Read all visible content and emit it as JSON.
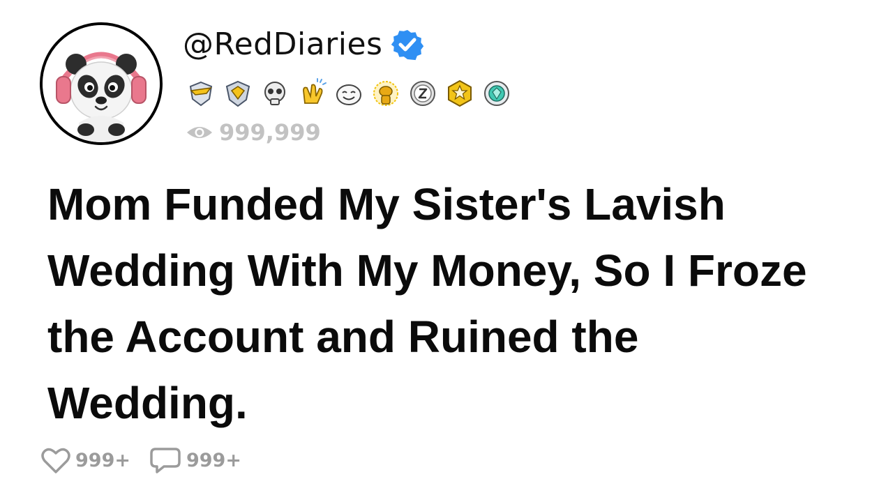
{
  "profile": {
    "username": "@RedDiaries",
    "verified": true,
    "views": "999,999",
    "badges": [
      "shield-wings-badge-icon",
      "diamond-shield-badge-icon",
      "skull-badge-icon",
      "clapping-hands-badge-icon",
      "laughing-face-badge-icon",
      "golden-alien-badge-icon",
      "z-medal-badge-icon",
      "star-shield-badge-icon",
      "gem-medal-badge-icon"
    ]
  },
  "post": {
    "title": "Mom Funded My Sister's Lavish Wedding With My Money, So I Froze the Account and Ruined the Wedding."
  },
  "stats": {
    "likes": "999+",
    "comments": "999+"
  },
  "colors": {
    "verified_blue": "#2f8ff3",
    "muted_gray": "#9b9b9b",
    "headphone_pink": "#ef7f93"
  }
}
